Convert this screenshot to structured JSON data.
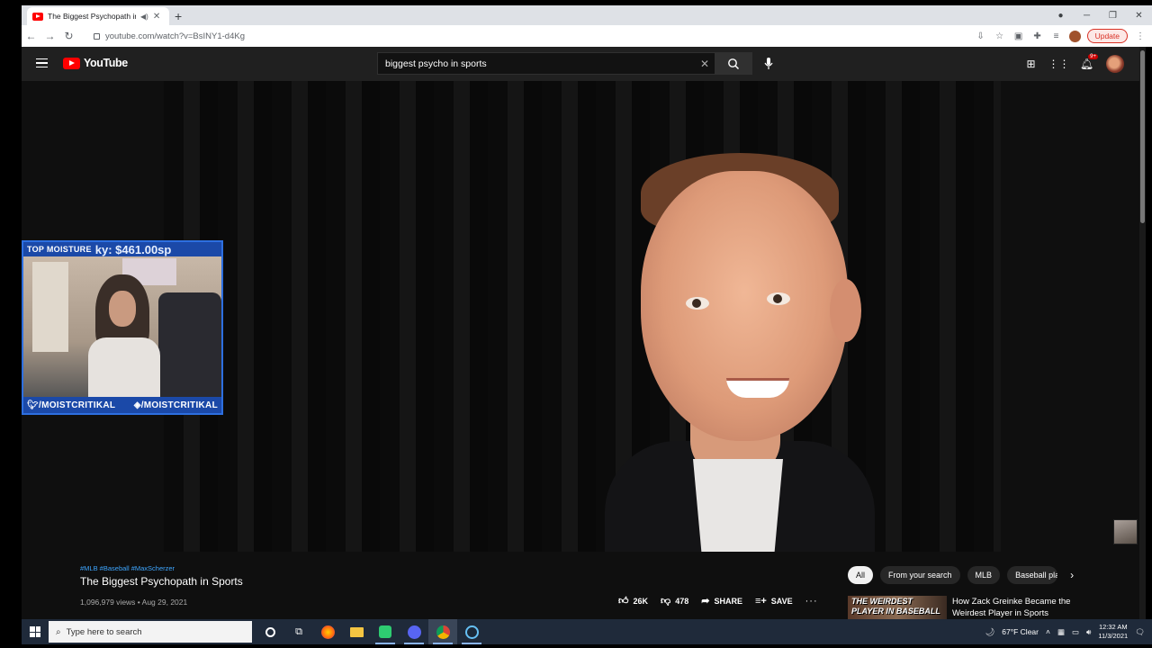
{
  "browser": {
    "tab_title": "The Biggest Psychopath in Sports",
    "url": "youtube.com/watch?v=BsINY1-d4Kg",
    "update_label": "Update"
  },
  "youtube": {
    "logo_text": "YouTube",
    "search_query": "biggest psycho in sports",
    "notifications_badge": "9+"
  },
  "overlay": {
    "top_label": "TOP MOISTURE",
    "top_amount": "ky: $461.00sp",
    "handle_twitter": "/MOISTCRITIKAL",
    "handle_twitch": "/MOISTCRITIKAL"
  },
  "video": {
    "hashtags": "#MLB #Baseball #MaxScherzer",
    "title": "The Biggest Psychopath in Sports",
    "meta": "1,096,979 views • Aug 29, 2021",
    "likes": "26K",
    "dislikes": "478",
    "share_label": "SHARE",
    "save_label": "SAVE"
  },
  "chips": [
    "All",
    "From your search",
    "MLB",
    "Baseball pla"
  ],
  "recommendation": {
    "thumb_text": "THE WEIRDEST PLAYER IN BASEBALL",
    "title": "How Zack Greinke Became the Weirdest Player in Sports"
  },
  "taskbar": {
    "search_placeholder": "Type here to search",
    "weather": "67°F  Clear",
    "time": "12:32 AM",
    "date": "11/3/2021"
  },
  "colors": {
    "youtube_red": "#ff0000",
    "link_blue": "#3ea6ff",
    "overlay_blue": "#1b49a8"
  }
}
